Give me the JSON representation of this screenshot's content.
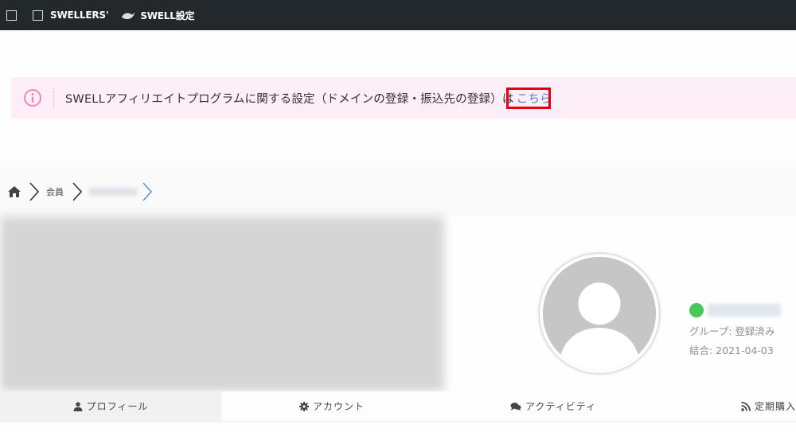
{
  "admin_bar": {
    "item1_label": "SWELLERS'",
    "item2_label": "SWELL設定"
  },
  "notice": {
    "text": "SWELLアフィリエイトプログラムに関する設定（ドメインの登録・振込先の登録）は",
    "link": "こちら"
  },
  "breadcrumb": {
    "level1": "会員"
  },
  "profile": {
    "group": "グループ: 登録済み",
    "joined": "結合: 2021-04-03"
  },
  "tabs": [
    {
      "label": "プロフィール",
      "icon": "user-icon"
    },
    {
      "label": "アカウント",
      "icon": "gear-icon"
    },
    {
      "label": "アクティビティ",
      "icon": "comments-icon"
    },
    {
      "label": "定期購入",
      "icon": "rss-icon"
    }
  ],
  "colors": {
    "admin_bar": "#23282d",
    "notice_bg": "#fdeef7",
    "notice_icon": "#e98bc0",
    "link": "#4a7fd8",
    "highlight": "#e6000f",
    "status": "#49c85a"
  }
}
